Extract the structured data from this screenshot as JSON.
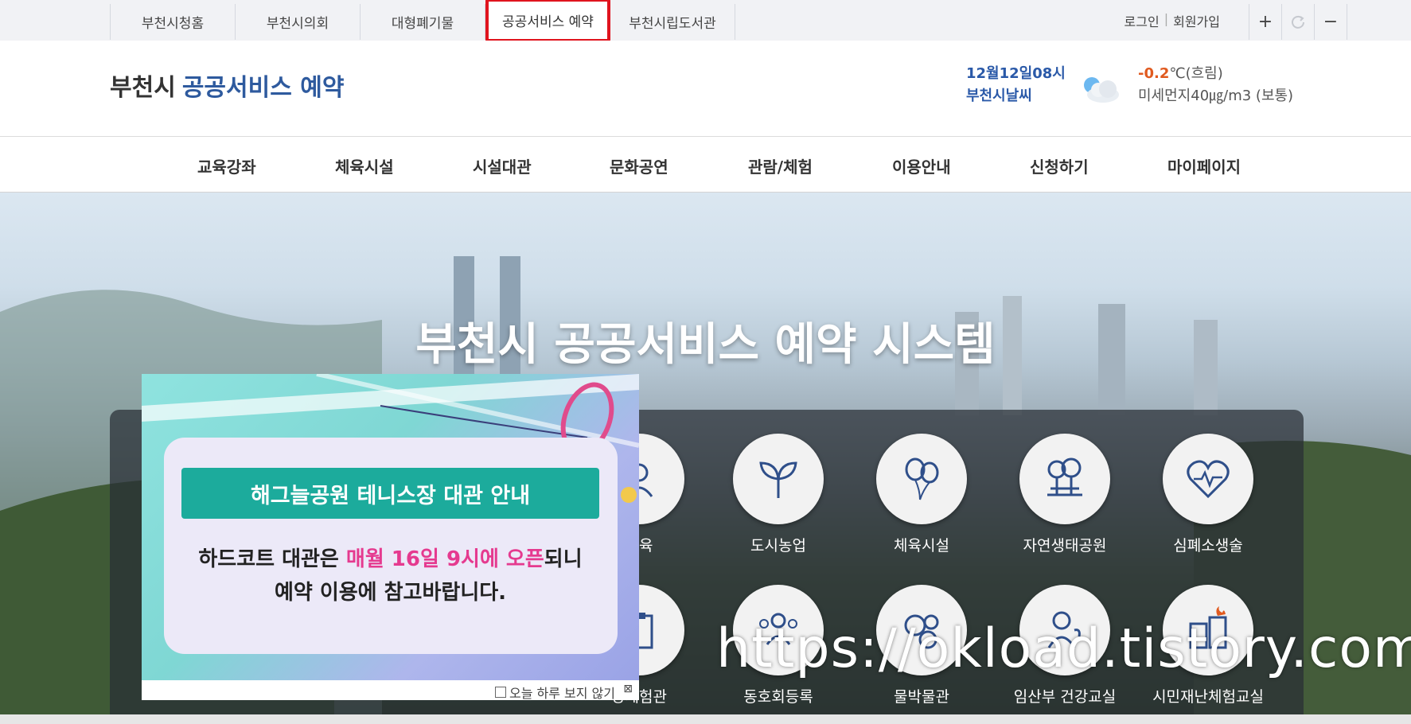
{
  "topbar": {
    "links": [
      "부천시청홈",
      "부천시의회",
      "대형폐기물",
      "공공서비스 예약",
      "부천시립도서관"
    ],
    "active_index": 3,
    "login": "로그인",
    "signup": "회원가입",
    "zoom_in": "+",
    "refresh": "C",
    "zoom_out": "−"
  },
  "header": {
    "logo_city": "부천시",
    "logo_service": "공공서비스 예약",
    "weather_date": "12월12일08시",
    "weather_place": "부천시날씨",
    "temp": "-0.2",
    "temp_unit": "℃(흐림)",
    "dust": "미세먼지40㎍/m3 (보통)"
  },
  "gnb": [
    "교육강좌",
    "체육시설",
    "시설대관",
    "문화공연",
    "관람/체험",
    "이용안내",
    "신청하기",
    "마이페이지"
  ],
  "hero": {
    "title": "부천시 공공서비스 예약 시스템"
  },
  "services_row1": [
    "교육",
    "도시농업",
    "체육시설",
    "자연생태공원",
    "심폐소생술"
  ],
  "services_row2": [
    "강체험관",
    "동호회등록",
    "물박물관",
    "임산부 건강교실",
    "시민재난체험교실"
  ],
  "popup": {
    "banner": "해그늘공원 테니스장 대관 안내",
    "msg_a": "하드코트 대관은 ",
    "msg_hl": "매월 16일 9시에 오픈",
    "msg_b": "되니",
    "msg_line2": "예약 이용에 참고바랍니다.",
    "dont_show": "오늘 하루 보지 않기",
    "close": "⊠"
  },
  "watermark": "https://okload.tistory.com"
}
